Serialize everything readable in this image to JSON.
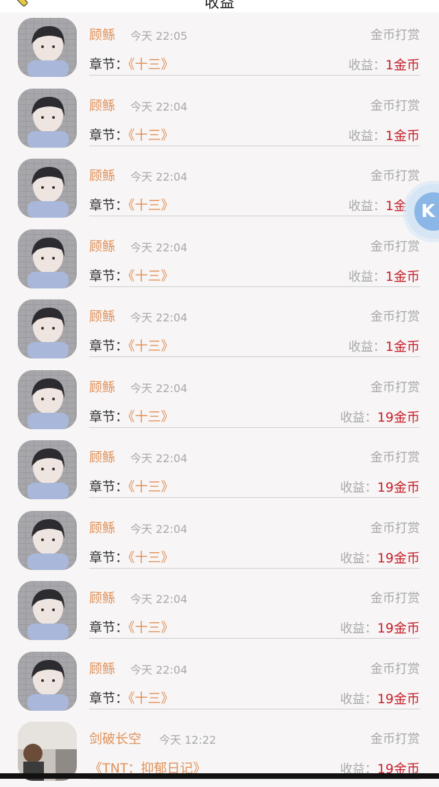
{
  "header": {
    "title": "收益"
  },
  "float_button": {
    "label": "K"
  },
  "records": [
    {
      "name": "顾鲧",
      "time": "今天 22:05",
      "type": "金币打赏",
      "chapter_label": "章节：",
      "chapter": "《十三》",
      "earnings_label": "收益：",
      "earnings": "1金币",
      "avatar": "avatar-a"
    },
    {
      "name": "顾鲧",
      "time": "今天 22:04",
      "type": "金币打赏",
      "chapter_label": "章节：",
      "chapter": "《十三》",
      "earnings_label": "收益：",
      "earnings": "1金币",
      "avatar": "avatar-a"
    },
    {
      "name": "顾鲧",
      "time": "今天 22:04",
      "type": "金币打赏",
      "chapter_label": "章节：",
      "chapter": "《十三》",
      "earnings_label": "收益：",
      "earnings": "1金币",
      "avatar": "avatar-a"
    },
    {
      "name": "顾鲧",
      "time": "今天 22:04",
      "type": "金币打赏",
      "chapter_label": "章节：",
      "chapter": "《十三》",
      "earnings_label": "收益：",
      "earnings": "1金币",
      "avatar": "avatar-a"
    },
    {
      "name": "顾鲧",
      "time": "今天 22:04",
      "type": "金币打赏",
      "chapter_label": "章节：",
      "chapter": "《十三》",
      "earnings_label": "收益：",
      "earnings": "1金币",
      "avatar": "avatar-a"
    },
    {
      "name": "顾鲧",
      "time": "今天 22:04",
      "type": "金币打赏",
      "chapter_label": "章节：",
      "chapter": "《十三》",
      "earnings_label": "收益：",
      "earnings": "19金币",
      "avatar": "avatar-a"
    },
    {
      "name": "顾鲧",
      "time": "今天 22:04",
      "type": "金币打赏",
      "chapter_label": "章节：",
      "chapter": "《十三》",
      "earnings_label": "收益：",
      "earnings": "19金币",
      "avatar": "avatar-a"
    },
    {
      "name": "顾鲧",
      "time": "今天 22:04",
      "type": "金币打赏",
      "chapter_label": "章节：",
      "chapter": "《十三》",
      "earnings_label": "收益：",
      "earnings": "19金币",
      "avatar": "avatar-a"
    },
    {
      "name": "顾鲧",
      "time": "今天 22:04",
      "type": "金币打赏",
      "chapter_label": "章节：",
      "chapter": "《十三》",
      "earnings_label": "收益：",
      "earnings": "19金币",
      "avatar": "avatar-a"
    },
    {
      "name": "顾鲧",
      "time": "今天 22:04",
      "type": "金币打赏",
      "chapter_label": "章节：",
      "chapter": "《十三》",
      "earnings_label": "收益：",
      "earnings": "19金币",
      "avatar": "avatar-a"
    },
    {
      "name": "剑破长空",
      "time": "今天 12:22",
      "type": "金币打赏",
      "chapter_label": "",
      "chapter": "《TNT：抑郁日记》",
      "earnings_label": "收益：",
      "earnings": "19金币",
      "avatar": "avatar-b"
    }
  ],
  "colors": {
    "name": "#e0915a",
    "earnings": "#c8202c",
    "muted": "#a9a9a9"
  }
}
